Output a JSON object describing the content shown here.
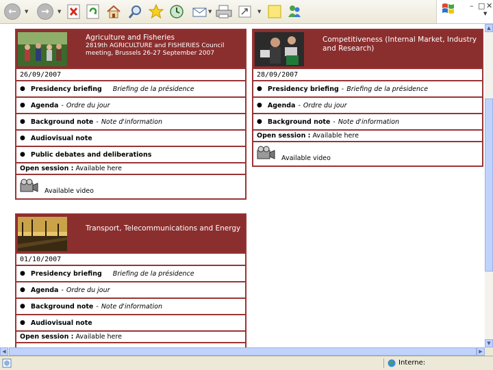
{
  "toolbar": {
    "back": "back-icon",
    "forward": "forward-icon",
    "stop": "stop-icon",
    "refresh": "refresh-icon",
    "home": "home-icon",
    "search": "search-icon",
    "favorites": "favorites-star-icon",
    "history": "history-icon",
    "mail": "mail-icon",
    "print": "print-icon",
    "edit": "edit-icon",
    "notes": "notes-icon",
    "messenger": "messenger-icon"
  },
  "panels": [
    {
      "title": "Agriculture and Fisheries",
      "subtitle": "2819th AGRICULTURE and FISHERIES Council meeting, Brussels 26-27 September 2007",
      "date": "26/09/2007",
      "presidency_en": "Presidency briefing",
      "presidency_fr": "Briefing de la présidence",
      "agenda_en": "Agenda",
      "agenda_fr": "Ordre du jour",
      "background_en": "Background note",
      "background_fr": "Note d'information",
      "audiovisual": "Audiovisual note",
      "debates": "Public debates and deliberations",
      "session_label": "Open session :",
      "session_value": "Available here",
      "video": "Available video"
    },
    {
      "title": "Competitiveness (Internal Market, Industry and Research)",
      "date": "28/09/2007",
      "presidency_en": "Presidency briefing",
      "presidency_fr": "Briefing de la présidence",
      "agenda_en": "Agenda",
      "agenda_fr": "Ordre du jour",
      "background_en": "Background note",
      "background_fr": "Note d'information",
      "session_label": "Open session :",
      "session_value": "Available here",
      "video": "Available video"
    },
    {
      "title": "Transport, Telecommunications and Energy",
      "date": "01/10/2007",
      "presidency_en": "Presidency briefing",
      "presidency_fr": "Briefing de la présidence",
      "agenda_en": "Agenda",
      "agenda_fr": "Ordre du jour",
      "background_en": "Background note",
      "background_fr": "Note d'information",
      "audiovisual": "Audiovisual note",
      "session_label": "Open session :",
      "session_value": "Available here"
    }
  ],
  "status": {
    "zone": "Interne:"
  },
  "colors": {
    "panel_header": "#8b2e2e",
    "panel_border": "#993333"
  }
}
